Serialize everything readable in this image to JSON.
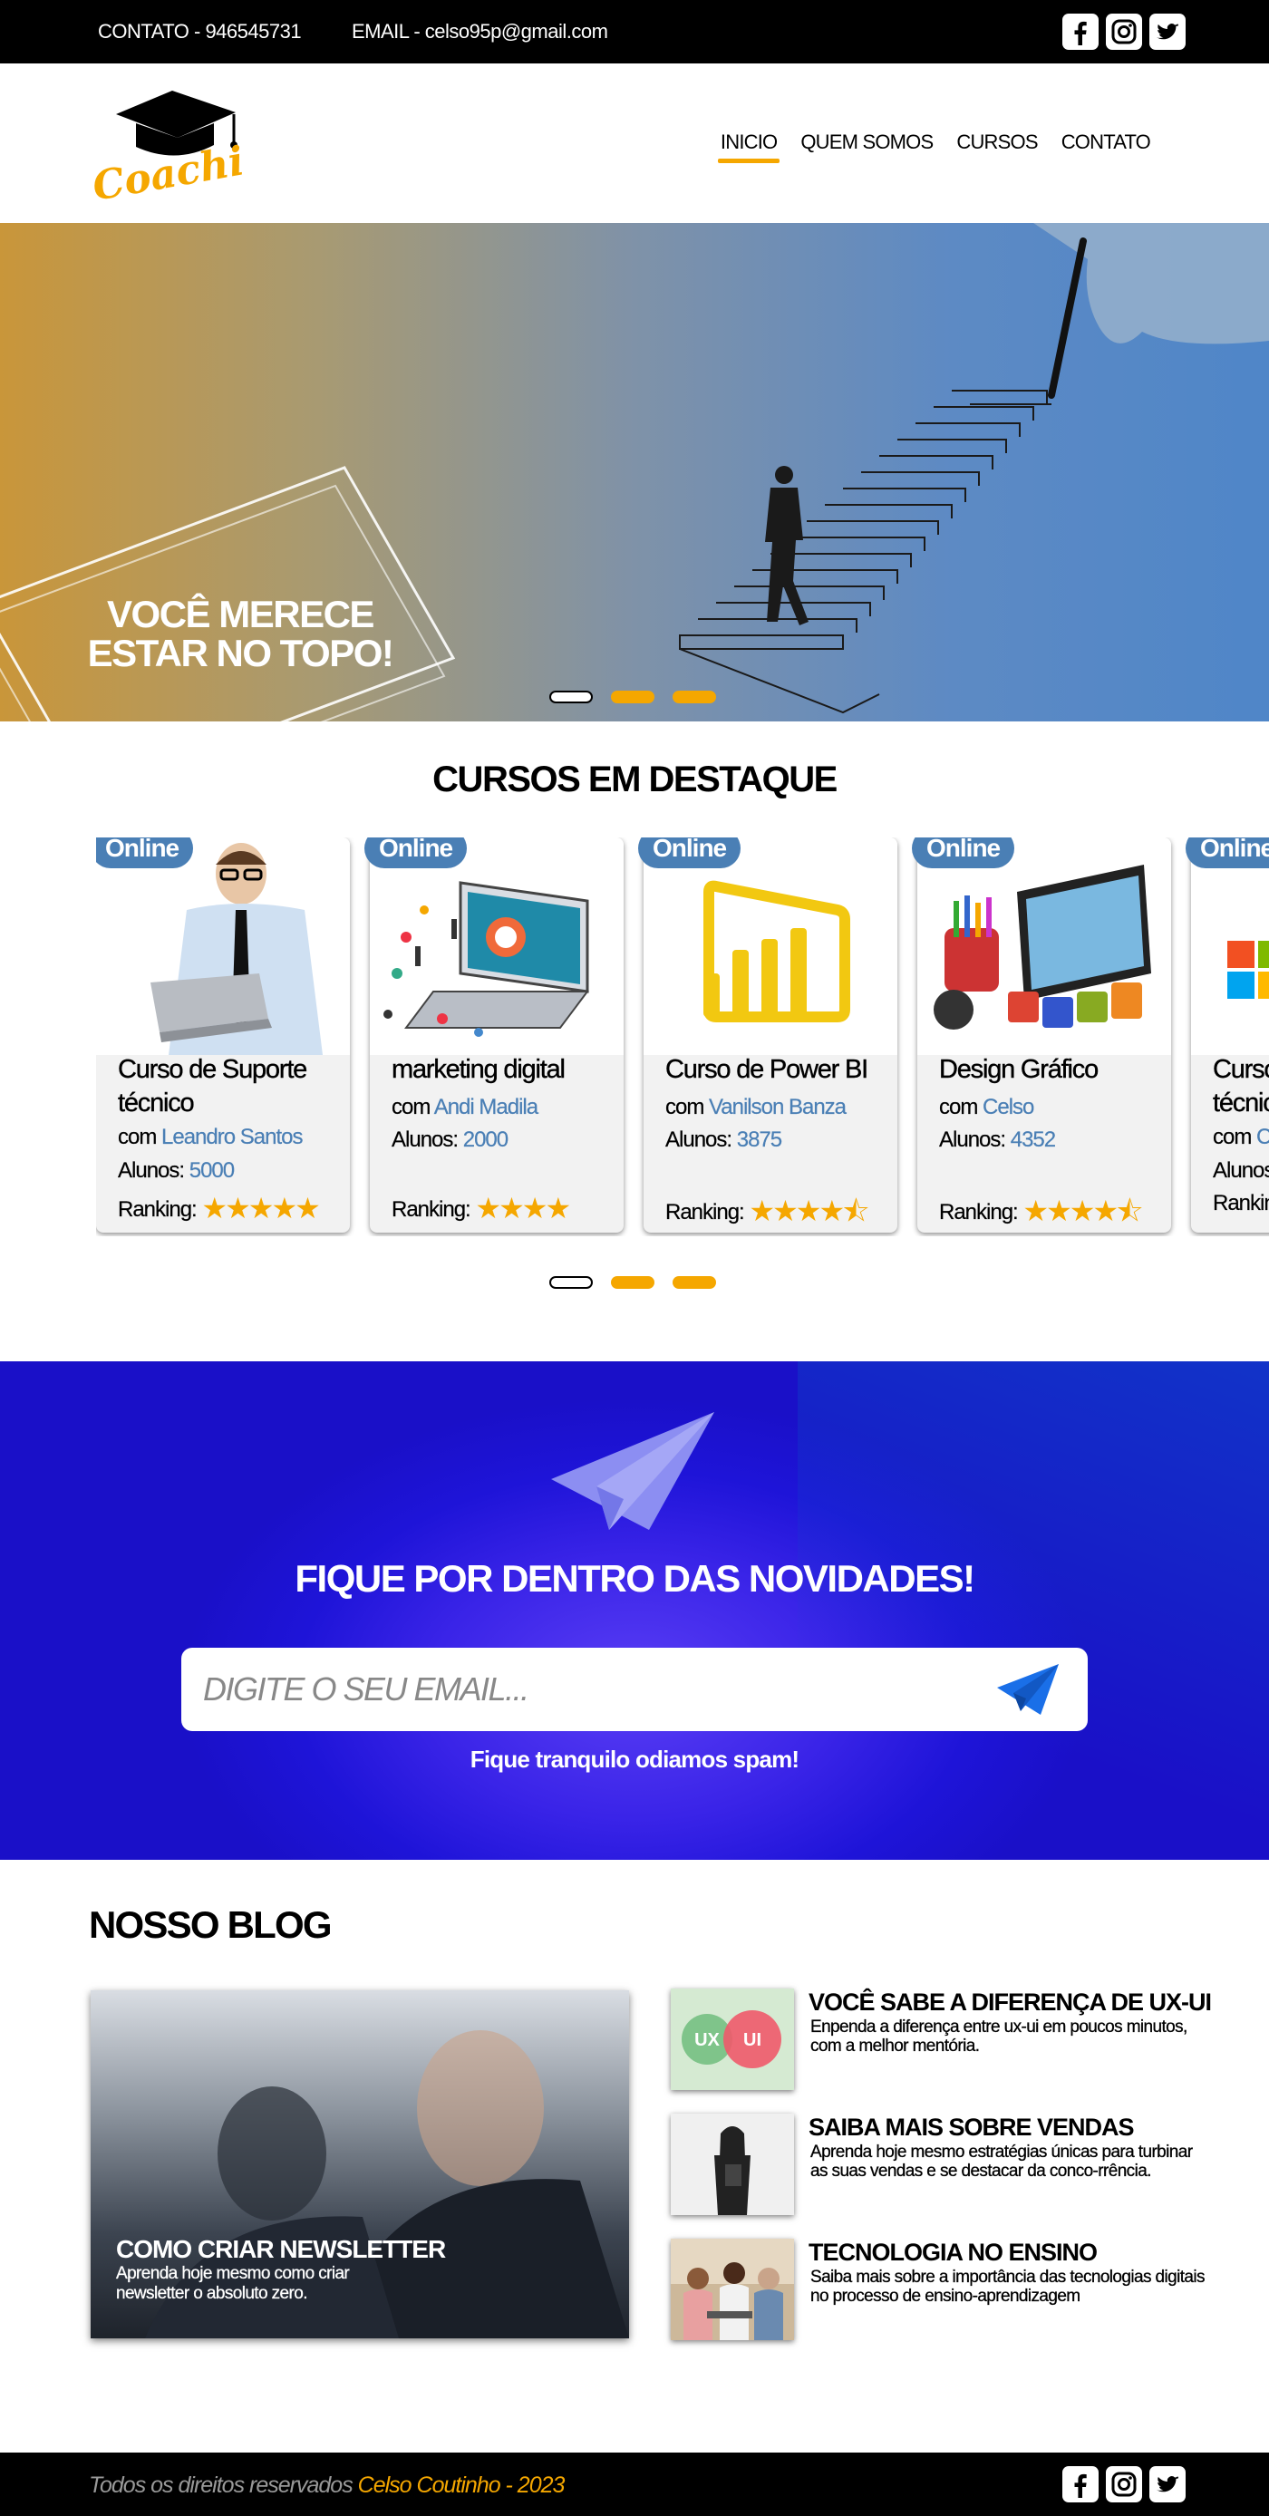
{
  "topbar": {
    "contact": "CONTATO - 946545731",
    "email": "EMAIL - celso95p@gmail.com"
  },
  "social_icons": [
    "facebook-icon",
    "instagram-icon",
    "twitter-icon"
  ],
  "logo": {
    "text": "Coaching"
  },
  "nav": [
    {
      "label": "INICIO",
      "active": true
    },
    {
      "label": "QUEM SOMOS",
      "active": false
    },
    {
      "label": "CURSOS",
      "active": false
    },
    {
      "label": "CONTATO",
      "active": false
    }
  ],
  "hero": {
    "headline_line1": "VOCÊ MERECE",
    "headline_line2": "ESTAR NO TOPO!",
    "slides": 3,
    "active_slide": 1
  },
  "courses": {
    "title": "CURSOS EM DESTAQUE",
    "items": [
      {
        "badge": "Online",
        "title": "Curso de Suporte técnico",
        "by_prefix": "com",
        "instructor": "Leandro Santos",
        "students_label": "Alunos:",
        "students": "5000",
        "ranking_label": "Ranking:",
        "rating": 5
      },
      {
        "badge": "Online",
        "title": "marketing digital",
        "by_prefix": "com",
        "instructor": "Andi Madila",
        "students_label": "Alunos:",
        "students": "2000",
        "ranking_label": "Ranking:",
        "rating": 4
      },
      {
        "badge": "Online",
        "title": "Curso de Power BI",
        "by_prefix": "com",
        "instructor": "Vanilson Banza",
        "students_label": "Alunos:",
        "students": "3875",
        "ranking_label": "Ranking:",
        "rating": 4.5
      },
      {
        "badge": "Online",
        "title": "Design Gráfico",
        "by_prefix": "com",
        "instructor": "Celso",
        "students_label": "Alunos:",
        "students": "4352",
        "ranking_label": "Ranking:",
        "rating": 4.5
      },
      {
        "badge": "Online",
        "title": "Curso de Excel técnico",
        "by_prefix": "com",
        "instructor": "Celso",
        "students_label": "Alunos:",
        "students": "",
        "ranking_label": "Ranking:",
        "rating": 0
      }
    ],
    "slides": 3,
    "active_slide": 1
  },
  "newsletter": {
    "title": "FIQUE POR DENTRO DAS NOVIDADES!",
    "placeholder": "DIGITE O SEU EMAIL...",
    "note": "Fique tranquilo odiamos spam!"
  },
  "blog": {
    "title": "NOSSO BLOG",
    "featured": {
      "title": "COMO CRIAR NEWSLETTER",
      "description": "Aprenda hoje mesmo como criar newsletter o absoluto zero."
    },
    "posts": [
      {
        "title": "VOCÊ SABE A DIFERENÇA DE UX-UI",
        "description": "Enpenda a diferença entre ux-ui em poucos minutos, com a melhor mentória.",
        "thumb_ux": "UX",
        "thumb_ui": "UI"
      },
      {
        "title": "SAIBA MAIS SOBRE VENDAS",
        "description": "Aprenda hoje mesmo estratégias únicas para turbinar as suas vendas e se destacar da conco-rrência."
      },
      {
        "title": "TECNOLOGIA NO ENSINO",
        "description": "Saiba mais sobre a importância das tecnologias digitais no processo de ensino-aprendizagem"
      }
    ]
  },
  "footer": {
    "copy_prefix": "Todos os direitos reservados",
    "copy_name": "Celso Coutinho - 2023"
  },
  "colors": {
    "accent": "#f5a700",
    "link_blue": "#4a7fb5",
    "newsletter_bg": "#2a1ee0"
  }
}
